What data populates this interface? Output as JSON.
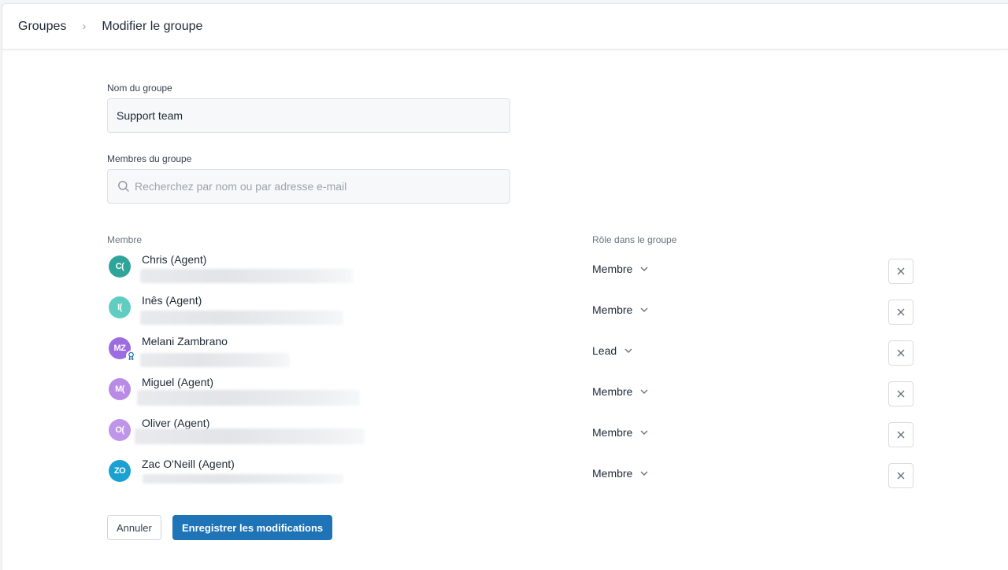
{
  "breadcrumb": {
    "parent": "Groupes",
    "separator": "›",
    "current": "Modifier le groupe"
  },
  "group_name": {
    "label": "Nom du groupe",
    "value": "Support team"
  },
  "members_search": {
    "label": "Membres du groupe",
    "placeholder": "Recherchez par nom ou par adresse e-mail"
  },
  "table": {
    "col_member": "Membre",
    "col_role": "Rôle dans le groupe"
  },
  "members": [
    {
      "initials": "C(",
      "name": "Chris (Agent)",
      "role": "Membre",
      "avatar_color": "#2fa59a"
    },
    {
      "initials": "I(",
      "name": "Inês (Agent)",
      "role": "Membre",
      "avatar_color": "#5fcdc2"
    },
    {
      "initials": "MZ",
      "name": "Melani Zambrano",
      "role": "Lead",
      "avatar_color": "#9c6ce0",
      "lead": true
    },
    {
      "initials": "M(",
      "name": "Miguel (Agent)",
      "role": "Membre",
      "avatar_color": "#b98be6"
    },
    {
      "initials": "O(",
      "name": "Oliver (Agent)",
      "role": "Membre",
      "avatar_color": "#bf95ea"
    },
    {
      "initials": "ZO",
      "name": "Zac O'Neill (Agent)",
      "role": "Membre",
      "avatar_color": "#1aa0d1"
    }
  ],
  "actions": {
    "cancel": "Annuler",
    "save": "Enregistrer les modifications"
  },
  "colors": {
    "primary": "#1f73b7",
    "field_bg": "#f6f8fa"
  }
}
